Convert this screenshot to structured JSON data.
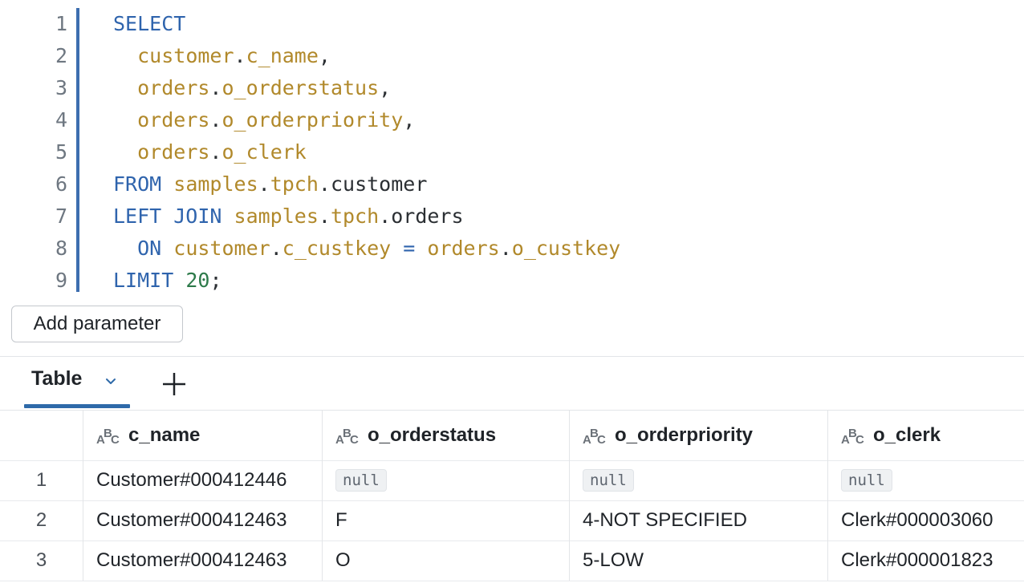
{
  "editor": {
    "lines": [
      {
        "n": "1",
        "tokens": [
          {
            "t": "SELECT",
            "c": "kw"
          }
        ]
      },
      {
        "n": "2",
        "tokens": [
          {
            "t": "  "
          },
          {
            "t": "customer",
            "c": "id"
          },
          {
            "t": ".",
            "c": "pl"
          },
          {
            "t": "c_name",
            "c": "id"
          },
          {
            "t": ",",
            "c": "pl"
          }
        ]
      },
      {
        "n": "3",
        "tokens": [
          {
            "t": "  "
          },
          {
            "t": "orders",
            "c": "id"
          },
          {
            "t": ".",
            "c": "pl"
          },
          {
            "t": "o_orderstatus",
            "c": "id"
          },
          {
            "t": ",",
            "c": "pl"
          }
        ]
      },
      {
        "n": "4",
        "tokens": [
          {
            "t": "  "
          },
          {
            "t": "orders",
            "c": "id"
          },
          {
            "t": ".",
            "c": "pl"
          },
          {
            "t": "o_orderpriority",
            "c": "id"
          },
          {
            "t": ",",
            "c": "pl"
          }
        ]
      },
      {
        "n": "5",
        "tokens": [
          {
            "t": "  "
          },
          {
            "t": "orders",
            "c": "id"
          },
          {
            "t": ".",
            "c": "pl"
          },
          {
            "t": "o_clerk",
            "c": "id"
          }
        ]
      },
      {
        "n": "6",
        "tokens": [
          {
            "t": "FROM",
            "c": "kw"
          },
          {
            "t": " "
          },
          {
            "t": "samples",
            "c": "id"
          },
          {
            "t": ".",
            "c": "pl"
          },
          {
            "t": "tpch",
            "c": "id"
          },
          {
            "t": ".customer",
            "c": "pl"
          }
        ]
      },
      {
        "n": "7",
        "tokens": [
          {
            "t": "LEFT JOIN",
            "c": "kw"
          },
          {
            "t": " "
          },
          {
            "t": "samples",
            "c": "id"
          },
          {
            "t": ".",
            "c": "pl"
          },
          {
            "t": "tpch",
            "c": "id"
          },
          {
            "t": ".orders",
            "c": "pl"
          }
        ]
      },
      {
        "n": "8",
        "tokens": [
          {
            "t": "  "
          },
          {
            "t": "ON",
            "c": "kw"
          },
          {
            "t": " "
          },
          {
            "t": "customer",
            "c": "id"
          },
          {
            "t": ".",
            "c": "pl"
          },
          {
            "t": "c_custkey",
            "c": "id"
          },
          {
            "t": " = ",
            "c": "kw"
          },
          {
            "t": "orders",
            "c": "id"
          },
          {
            "t": ".",
            "c": "pl"
          },
          {
            "t": "o_custkey",
            "c": "id"
          }
        ]
      },
      {
        "n": "9",
        "tokens": [
          {
            "t": "LIMIT",
            "c": "kw"
          },
          {
            "t": " "
          },
          {
            "t": "20",
            "c": "num"
          },
          {
            "t": ";",
            "c": "pl"
          }
        ]
      }
    ]
  },
  "add_parameter_label": "Add parameter",
  "tabs": {
    "active_label": "Table",
    "chevron_icon": "chevron-down-icon",
    "add_icon": "plus-icon"
  },
  "table": {
    "type_icon": "string-type-icon",
    "type_icon_glyphs": [
      "A",
      "B",
      "C"
    ],
    "columns": [
      "c_name",
      "o_orderstatus",
      "o_orderpriority",
      "o_clerk"
    ],
    "null_label": "null",
    "rows": [
      {
        "num": "1",
        "cells": [
          "Customer#000412446",
          null,
          null,
          null
        ]
      },
      {
        "num": "2",
        "cells": [
          "Customer#000412463",
          "F",
          "4-NOT SPECIFIED",
          "Clerk#000003060"
        ]
      },
      {
        "num": "3",
        "cells": [
          "Customer#000412463",
          "O",
          "5-LOW",
          "Clerk#000001823"
        ]
      }
    ]
  }
}
